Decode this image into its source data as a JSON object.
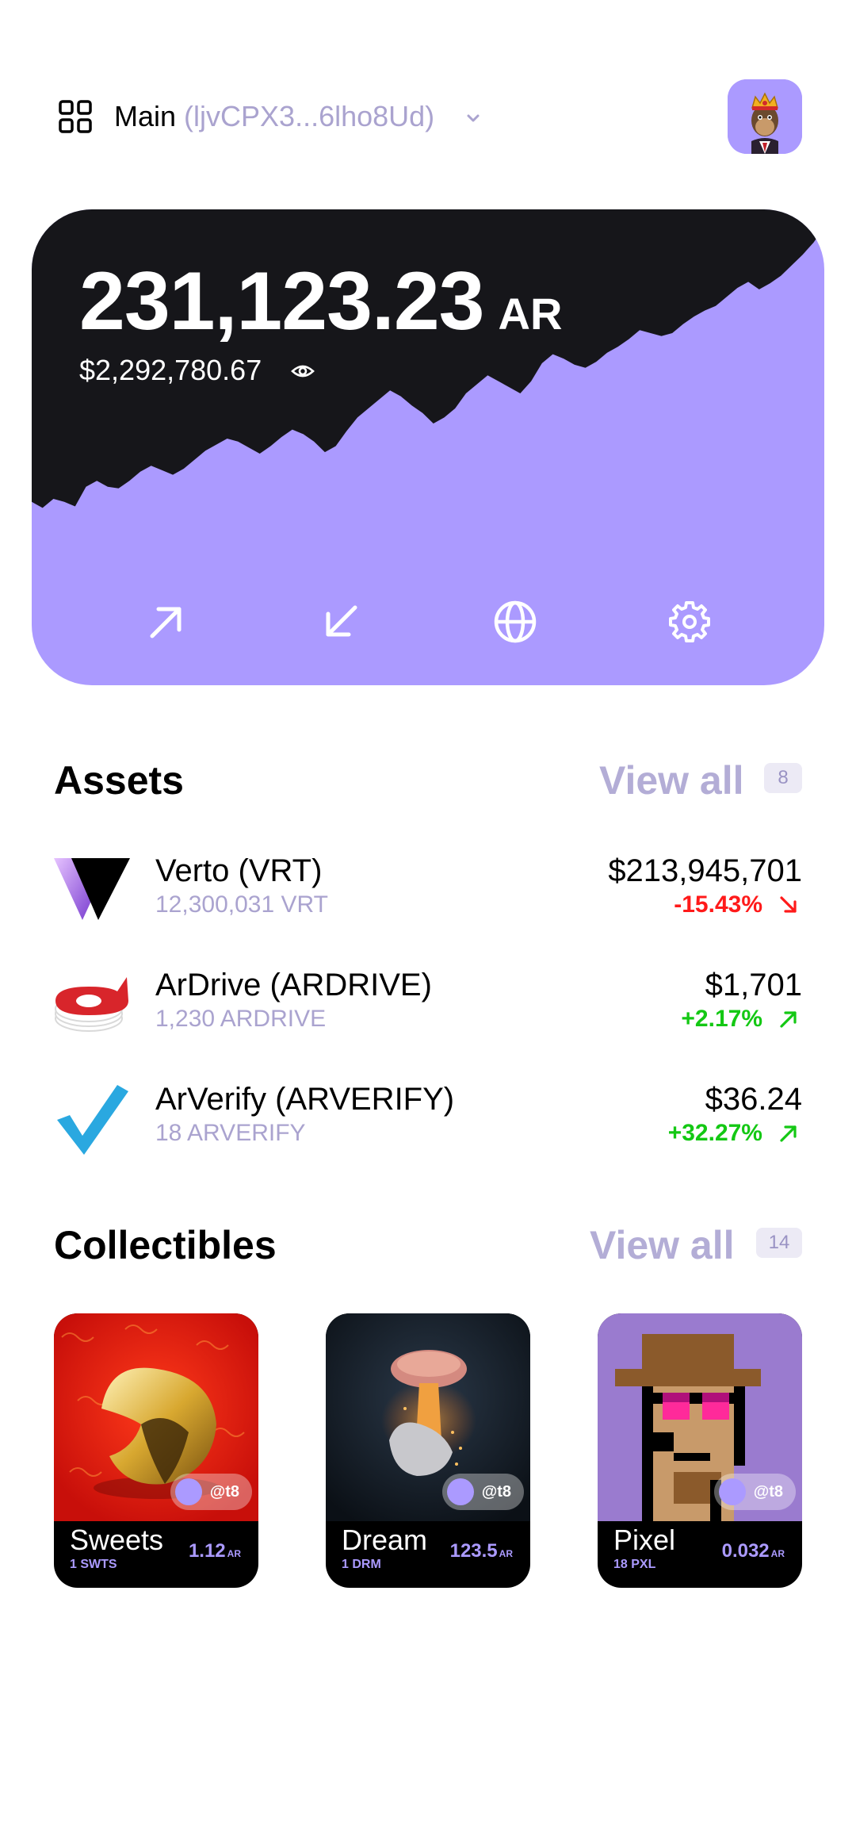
{
  "header": {
    "wallet_name": "Main",
    "wallet_address": "(ljvCPX3...6lho8Ud)",
    "menu_icon": "grid-icon",
    "dropdown_icon": "chevron-down-icon",
    "avatar_icon": "ape-avatar"
  },
  "balance": {
    "amount": "231,123.23",
    "unit": "AR",
    "usd": "$2,292,780.67",
    "visibility_icon": "eye-icon",
    "chart_values": [
      48,
      44,
      50,
      48,
      45,
      58,
      62,
      58,
      57,
      62,
      68,
      72,
      69,
      66,
      70,
      76,
      82,
      86,
      90,
      88,
      84,
      80,
      85,
      91,
      96,
      93,
      88,
      81,
      85,
      95,
      104,
      110,
      116,
      122,
      118,
      112,
      107,
      100,
      104,
      110,
      120,
      126,
      132,
      128,
      124,
      120,
      128,
      140,
      146,
      143,
      139,
      137,
      141,
      147,
      151,
      156,
      162,
      160,
      158,
      160,
      166,
      171,
      175,
      178,
      184,
      190,
      194,
      189,
      193,
      198,
      205,
      212,
      220,
      230
    ],
    "actions": [
      {
        "name": "send",
        "icon": "arrow-up-right-icon"
      },
      {
        "name": "receive",
        "icon": "arrow-down-left-icon"
      },
      {
        "name": "explore",
        "icon": "globe-icon"
      },
      {
        "name": "settings",
        "icon": "gear-icon"
      }
    ]
  },
  "assets": {
    "title": "Assets",
    "view_all": "View all",
    "count": "8",
    "items": [
      {
        "name": "Verto (VRT)",
        "qty": "12,300,031 VRT",
        "value": "$213,945,701",
        "change": "-15.43%",
        "direction": "down"
      },
      {
        "name": "ArDrive (ARDRIVE)",
        "qty": "1,230 ARDRIVE",
        "value": "$1,701",
        "change": "+2.17%",
        "direction": "up"
      },
      {
        "name": "ArVerify (ARVERIFY)",
        "qty": "18 ARVERIFY",
        "value": "$36.24",
        "change": "+32.27%",
        "direction": "up"
      }
    ]
  },
  "collectibles": {
    "title": "Collectibles",
    "view_all": "View all",
    "count": "14",
    "items": [
      {
        "title": "Sweets",
        "sub": "1 SWTS",
        "price": "1.12",
        "unit": "AR",
        "owner": "@t8"
      },
      {
        "title": "Dream",
        "sub": "1 DRM",
        "price": "123.5",
        "unit": "AR",
        "owner": "@t8"
      },
      {
        "title": "Pixel",
        "sub": "18 PXL",
        "price": "0.032",
        "unit": "AR",
        "owner": "@t8"
      }
    ]
  },
  "colors": {
    "accent": "#ab9aff",
    "card_dark": "#16161a",
    "muted": "#aaa3cf",
    "negative": "#ff1a1a",
    "positive": "#14c814"
  }
}
